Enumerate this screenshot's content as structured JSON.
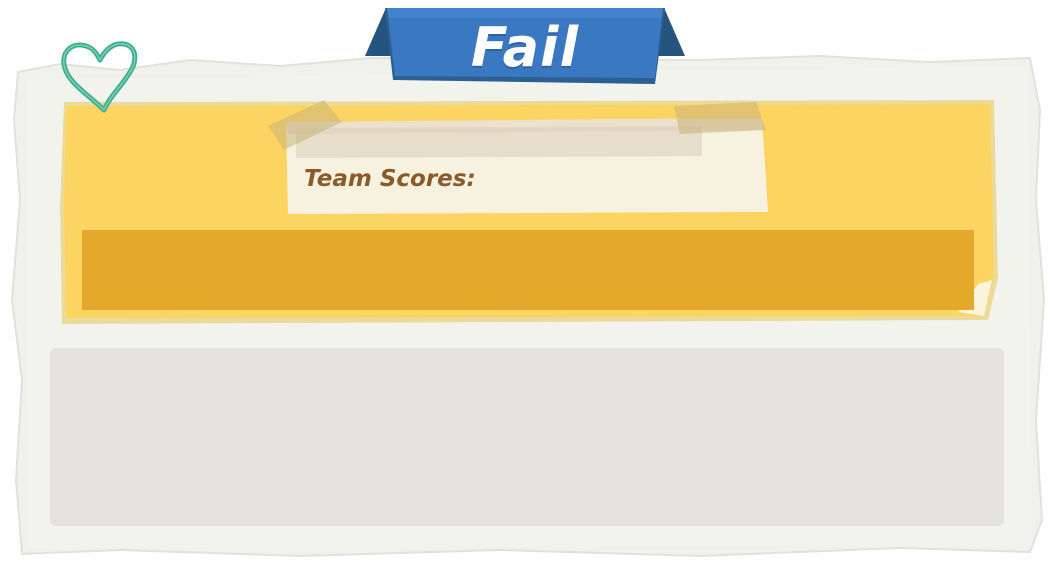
{
  "banner": {
    "title": "Fail",
    "color": "#3a78c2"
  },
  "heart": {
    "icon": "heart-outline-icon",
    "color": "#3fae8f"
  },
  "scores_panel": {
    "label": "Team Scores:",
    "board_color": "#fcd462",
    "bar_color": "#e4a92b"
  },
  "lower_panel": {
    "color": "#e4e3dd"
  }
}
